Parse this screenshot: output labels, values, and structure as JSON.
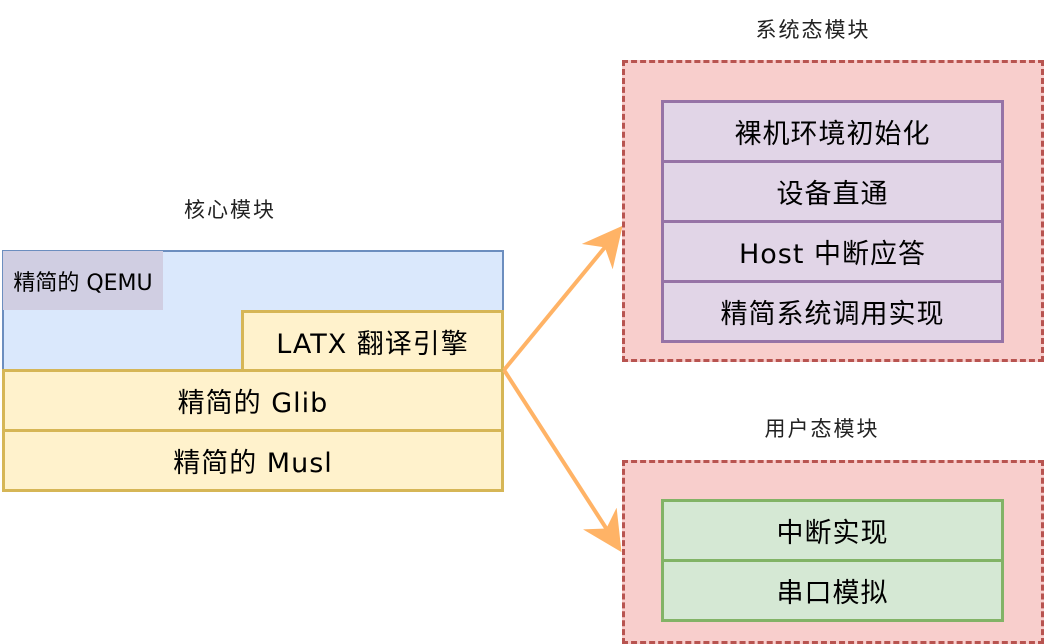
{
  "core": {
    "caption": "核心模块",
    "qemu_label": "精简的 QEMU",
    "latx_label": "LATX 翻译引擎",
    "glib_label": "精简的 Glib",
    "musl_label": "精简的 Musl"
  },
  "system": {
    "caption": "系统态模块",
    "items": [
      "裸机环境初始化",
      "设备直通",
      "Host 中断应答",
      "精简系统调用实现"
    ]
  },
  "user": {
    "caption": "用户态模块",
    "items": [
      "中断实现",
      "串口模拟"
    ]
  },
  "colors": {
    "qemu_fill": "#dae8fc",
    "qemu_stroke": "#6c8ebf",
    "qemu_tag_fill": "#d0cee2",
    "yellow_fill": "#fff2cc",
    "yellow_stroke": "#d6b656",
    "red_fill": "#f8cecc",
    "red_stroke": "#b85450",
    "purple_fill": "#e1d5e7",
    "purple_stroke": "#9673a6",
    "green_fill": "#d5e8d4",
    "green_stroke": "#82b366",
    "arrow": "#ffb366"
  }
}
